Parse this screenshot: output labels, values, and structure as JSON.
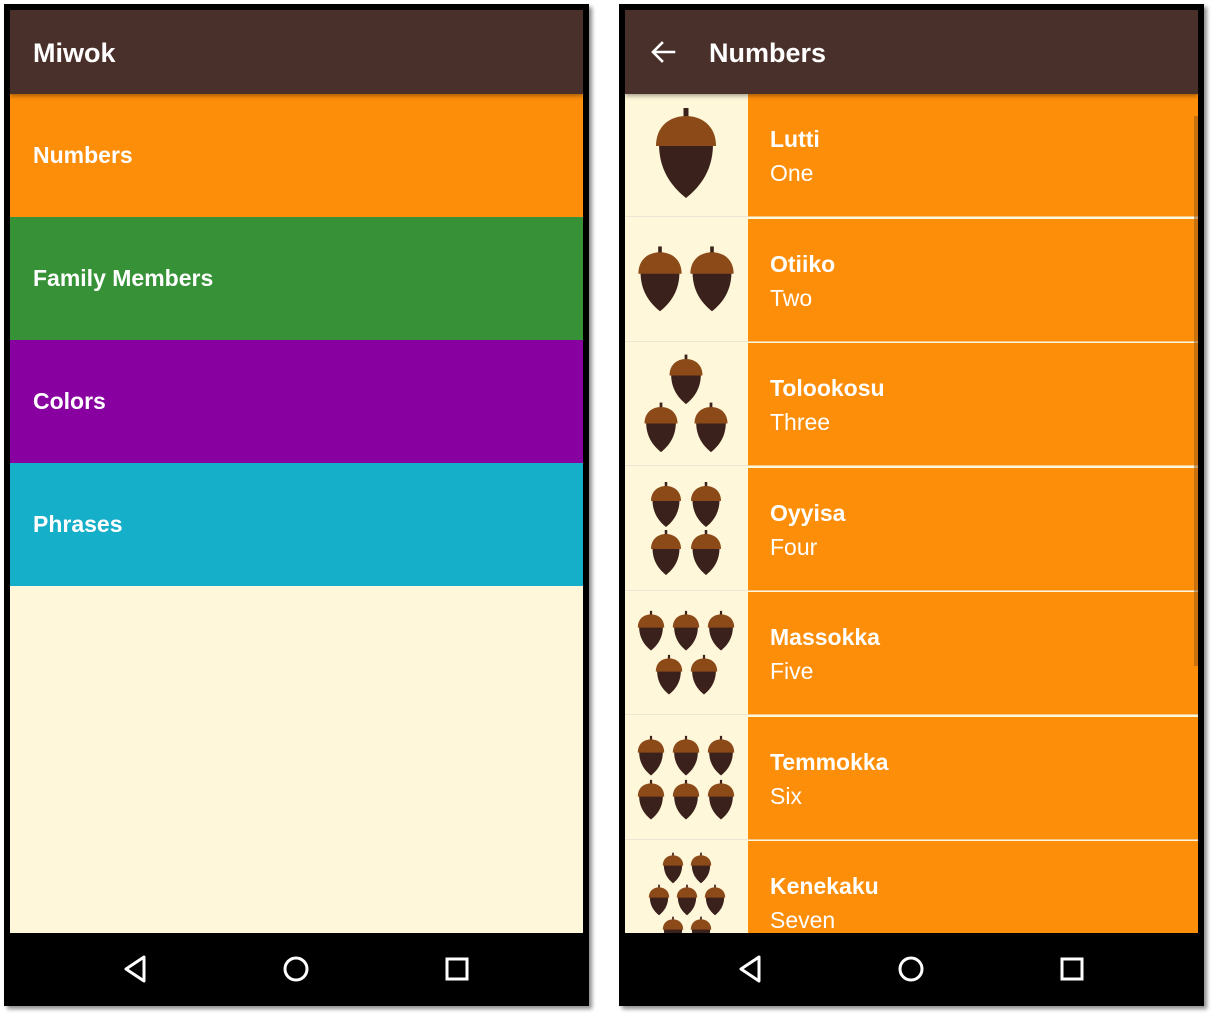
{
  "colors": {
    "app_bar": "#4A302A",
    "background": "#FFF7DA",
    "numbers": "#FD8E09",
    "family": "#379237",
    "colors_cat": "#8800A0",
    "phrases": "#16AFCA",
    "acorn_cap": "#8B4A18",
    "acorn_body": "#3B211B"
  },
  "left_screen": {
    "app_title": "Miwok",
    "categories": [
      {
        "label": "Numbers",
        "color": "#FD8E09"
      },
      {
        "label": "Family Members",
        "color": "#379237"
      },
      {
        "label": "Colors",
        "color": "#8800A0"
      },
      {
        "label": "Phrases",
        "color": "#16AFCA"
      }
    ]
  },
  "right_screen": {
    "app_title": "Numbers",
    "back_icon": "arrow-left-icon",
    "items": [
      {
        "miwok": "Lutti",
        "english": "One",
        "acorns": 1
      },
      {
        "miwok": "Otiiko",
        "english": "Two",
        "acorns": 2
      },
      {
        "miwok": "Tolookosu",
        "english": "Three",
        "acorns": 3
      },
      {
        "miwok": "Oyyisa",
        "english": "Four",
        "acorns": 4
      },
      {
        "miwok": "Massokka",
        "english": "Five",
        "acorns": 5
      },
      {
        "miwok": "Temmokka",
        "english": "Six",
        "acorns": 6
      },
      {
        "miwok": "Kenekaku",
        "english": "Seven",
        "acorns": 7
      }
    ]
  },
  "nav_bar": {
    "buttons": [
      "back-triangle-icon",
      "home-circle-icon",
      "recents-square-icon"
    ]
  }
}
